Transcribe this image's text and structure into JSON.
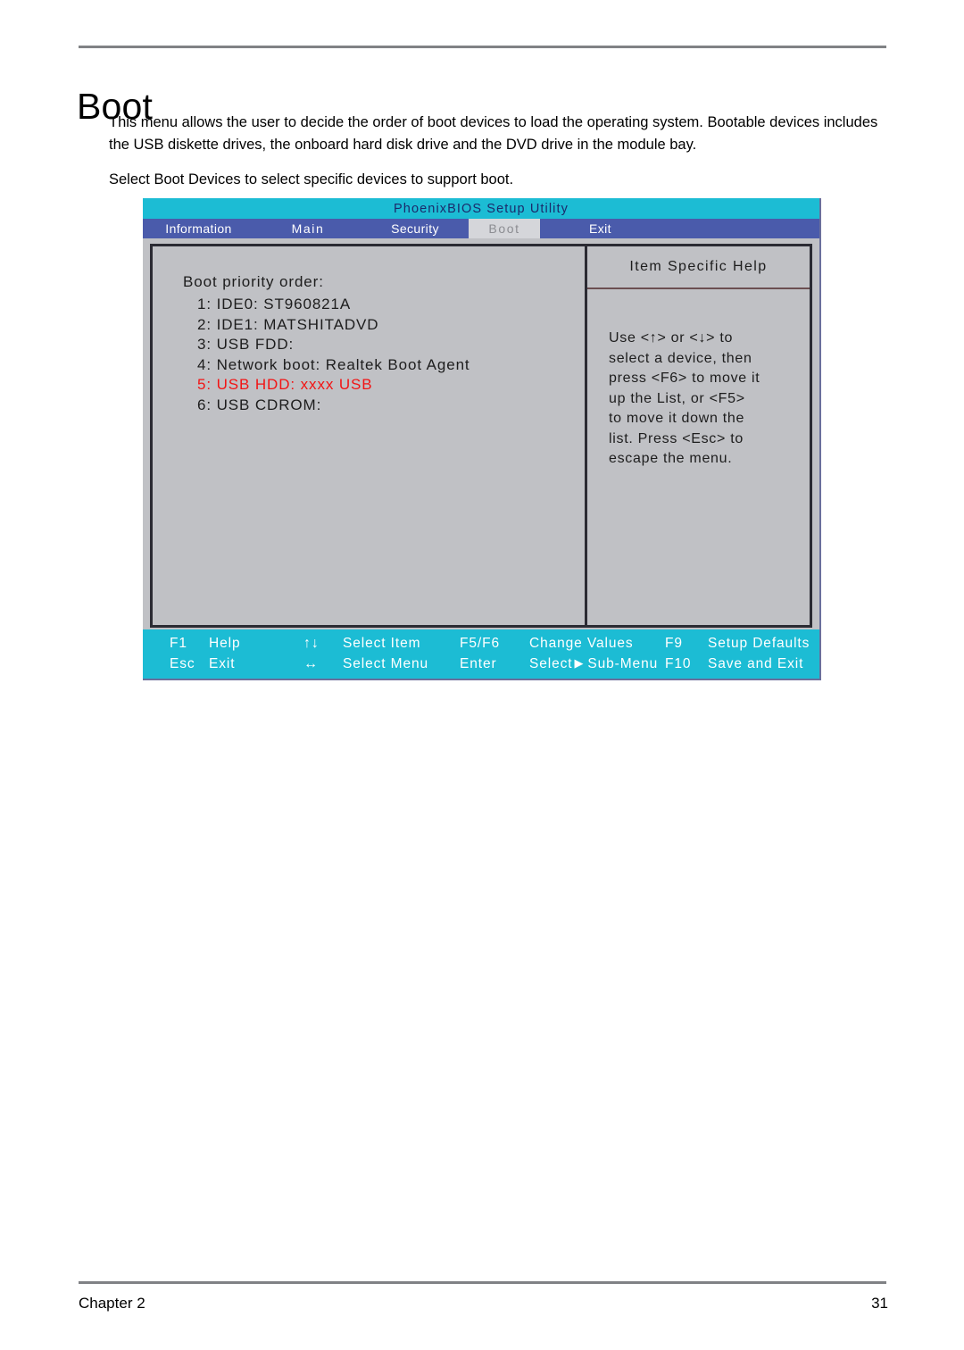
{
  "document": {
    "title": "Boot",
    "paragraphs": [
      "This menu allows the user to decide the order of boot devices to load the operating system. Bootable devices includes the USB diskette drives, the onboard hard disk drive and the DVD drive in the module bay.",
      "Select Boot Devices to select specific devices to support boot."
    ],
    "footer": {
      "chapter": "Chapter 2",
      "page_number": "31"
    }
  },
  "bios": {
    "utility_title": "PhoenixBIOS Setup Utility",
    "tabs": [
      {
        "label": "Information",
        "active": false
      },
      {
        "label": "Main",
        "active": false
      },
      {
        "label": "Security",
        "active": false
      },
      {
        "label": "Boot",
        "active": true
      },
      {
        "label": "Exit",
        "active": false
      }
    ],
    "main_pane": {
      "heading": "Boot priority order:",
      "items": [
        {
          "text": "1: IDE0: ST960821A",
          "highlighted": false
        },
        {
          "text": "2: IDE1: MATSHITADVD",
          "highlighted": false
        },
        {
          "text": "3: USB FDD:",
          "highlighted": false
        },
        {
          "text": "4: Network boot: Realtek Boot Agent",
          "highlighted": false
        },
        {
          "text": "5: USB HDD: xxxx USB",
          "highlighted": true
        },
        {
          "text": "6: USB CDROM:",
          "highlighted": false
        }
      ]
    },
    "help_pane": {
      "title": "Item Specific Help",
      "lines": [
        "Use <↑> or <↓> to",
        "select a device, then",
        "press <F6> to move it",
        "up the List, or <F5>",
        "to move it down the",
        "list. Press <Esc> to",
        "escape the menu."
      ]
    },
    "key_bar": {
      "row1": [
        {
          "key": "F1",
          "label": "Help"
        },
        {
          "key": "↑↓",
          "label": "Select  Item"
        },
        {
          "key": "F5/F6",
          "label": "Change  Values"
        },
        {
          "key": "F9",
          "label": "Setup  Defaults"
        }
      ],
      "row2": [
        {
          "key": "Esc",
          "label": "Exit"
        },
        {
          "key": "↔",
          "label": "Select  Menu"
        },
        {
          "key": "Enter",
          "label": "Select",
          "extra": "Sub-Menu",
          "triangle": "▶"
        },
        {
          "key": "F10",
          "label": "Save  and  Exit"
        }
      ]
    },
    "colors": {
      "title_bar": "#1cbcd4",
      "tab_bar": "#4a5bab",
      "active_tab": "#d5d6da",
      "panel_bg": "#c0c1c5",
      "panel_border": "#2b2b33",
      "highlight_text": "#f21414",
      "key_bar": "#1cbcd4"
    }
  }
}
